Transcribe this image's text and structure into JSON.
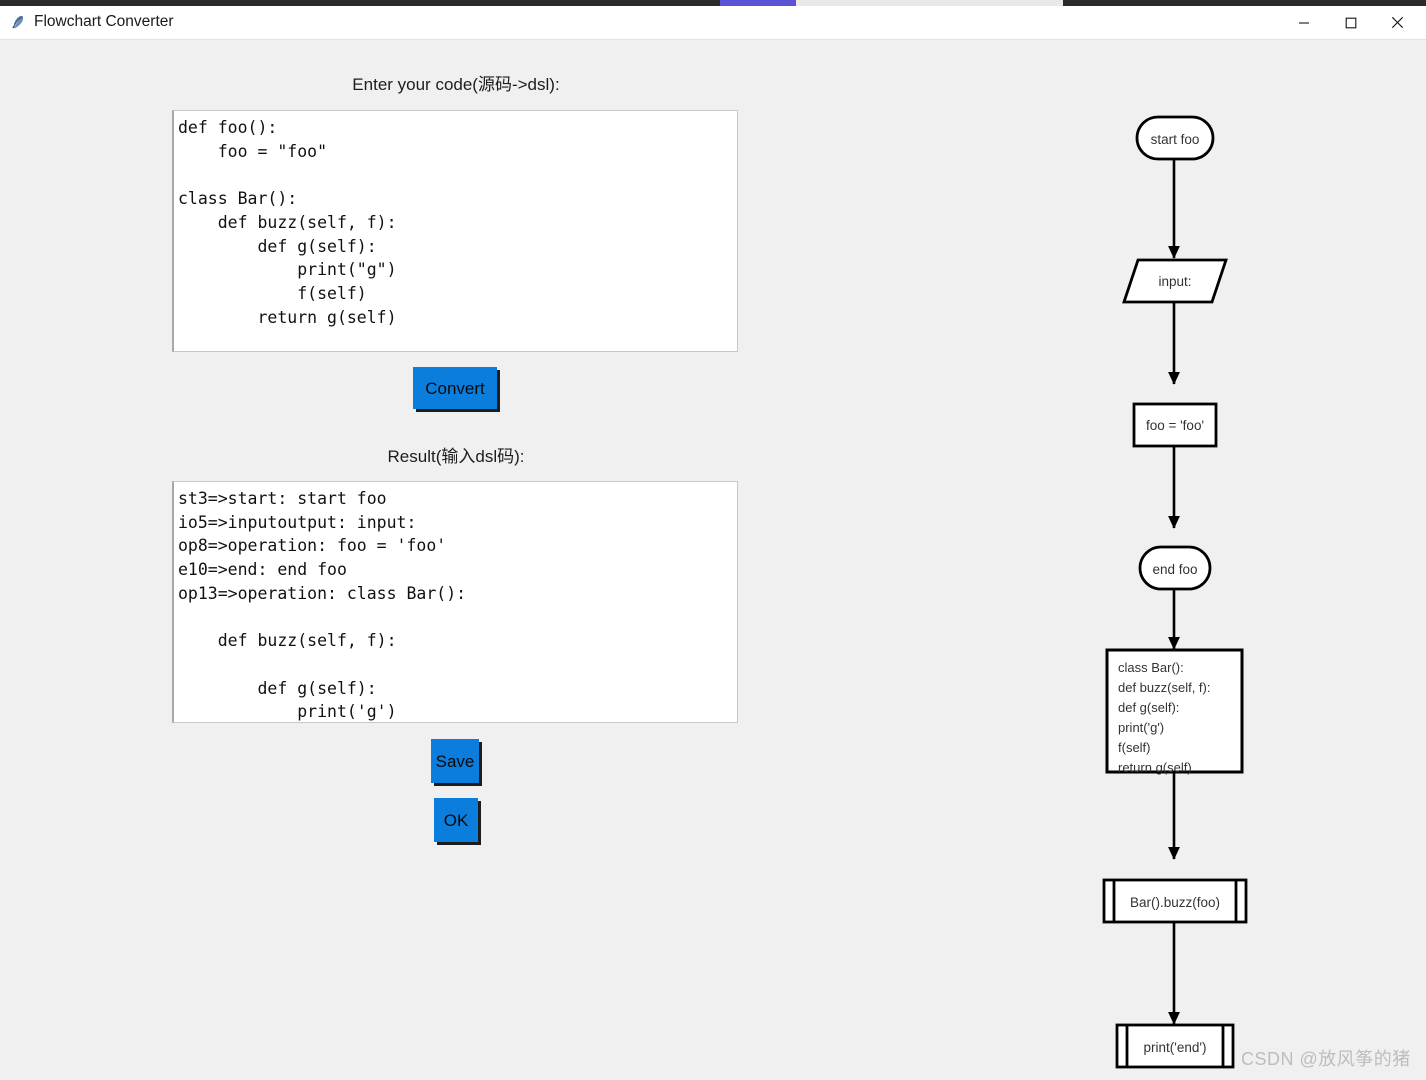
{
  "background_window": {
    "accent_color": "#5b53d6",
    "strip_color": "#2b2b2b"
  },
  "window": {
    "title": "Flowchart Converter",
    "icon": "feather-icon",
    "controls": {
      "minimize": "minimize-icon",
      "maximize": "maximize-icon",
      "close": "close-icon"
    }
  },
  "theme": {
    "background": "#f0f0f0",
    "button_accent": "#0b7ddd",
    "textarea_background": "#ffffff",
    "text_color": "#111111"
  },
  "form": {
    "code_label": "Enter your code(源码->dsl):",
    "result_label": "Result(输入dsl码):",
    "code_input": {
      "value": "def foo():\n    foo = \"foo\"\n\nclass Bar():\n    def buzz(self, f):\n        def g(self):\n            print(\"g\")\n            f(self)\n        return g(self)",
      "placeholder": ""
    },
    "result_output": {
      "value": "st3=>start: start foo\nio5=>inputoutput: input:\nop8=>operation: foo = 'foo'\ne10=>end: end foo\nop13=>operation: class Bar():\n\n    def buzz(self, f):\n\n        def g(self):\n            print('g')",
      "placeholder": ""
    },
    "buttons": {
      "convert": "Convert",
      "save": "Save",
      "ok": "OK"
    }
  },
  "flowchart": {
    "nodes": [
      {
        "id": "st3",
        "type": "terminal",
        "label": "start foo"
      },
      {
        "id": "io5",
        "type": "inputoutput",
        "label": "input:"
      },
      {
        "id": "op8",
        "type": "operation",
        "label": "foo = 'foo'"
      },
      {
        "id": "e10",
        "type": "terminal",
        "label": "end foo"
      },
      {
        "id": "op13",
        "type": "operation",
        "label": "class Bar():\ndef buzz(self, f):\ndef g(self):\nprint('g')\nf(self)\nreturn g(self)",
        "lines": [
          "class Bar():",
          "def buzz(self, f):",
          "def g(self):",
          "print('g')",
          "f(self)",
          "return g(self)"
        ]
      },
      {
        "id": "sub1",
        "type": "subroutine",
        "label": "Bar().buzz(foo)"
      },
      {
        "id": "sub2",
        "type": "subroutine",
        "label": "print('end')"
      }
    ],
    "edges": [
      {
        "from": "st3",
        "to": "io5"
      },
      {
        "from": "io5",
        "to": "op8"
      },
      {
        "from": "op8",
        "to": "e10"
      },
      {
        "from": "e10",
        "to": "op13"
      },
      {
        "from": "op13",
        "to": "sub1"
      },
      {
        "from": "sub1",
        "to": "sub2"
      }
    ],
    "stroke_color": "#000000",
    "fill_color": "#ffffff"
  },
  "watermark": "CSDN @放风筝的猪"
}
